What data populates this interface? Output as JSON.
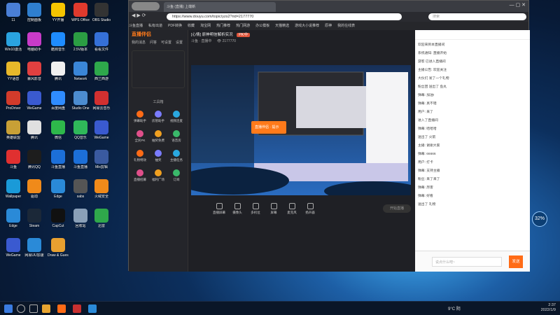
{
  "desktop": {
    "icons": [
      {
        "label": "11",
        "c": "#4a7fd6"
      },
      {
        "label": "控制面板",
        "c": "#2f7fcf"
      },
      {
        "label": "YY开播",
        "c": "#f5c400"
      },
      {
        "label": "WPS Office",
        "c": "#e03a2d"
      },
      {
        "label": "OBS Studio",
        "c": "#333"
      },
      {
        "label": "Win10激活",
        "c": "#2aa3e0"
      },
      {
        "label": "电脑助手",
        "c": "#c83bc8"
      },
      {
        "label": "酷狗音乐",
        "c": "#1e8cff"
      },
      {
        "label": "2.5V版本",
        "c": "#2b9d43"
      },
      {
        "label": "看看文件",
        "c": "#3570d8"
      },
      {
        "label": "YY语音",
        "c": "#e8b82a"
      },
      {
        "label": "暴风影音",
        "c": "#e04040"
      },
      {
        "label": "腾讯",
        "c": "#f0f0f0"
      },
      {
        "label": "Network",
        "c": "#3a86d8"
      },
      {
        "label": "西兰西游",
        "c": "#2ea84b"
      },
      {
        "label": "ProDriver",
        "c": "#d23b2b"
      },
      {
        "label": "WeGame",
        "c": "#3a5ad0"
      },
      {
        "label": "百度网盘",
        "c": "#2f8cff"
      },
      {
        "label": "Studio One",
        "c": "#4c8cd0"
      },
      {
        "label": "网易云音乐",
        "c": "#d23030"
      },
      {
        "label": "英雄联盟",
        "c": "#c8a036"
      },
      {
        "label": "腾讯",
        "c": "#e0e0e0"
      },
      {
        "label": "微信",
        "c": "#2eb84b"
      },
      {
        "label": "QQ音乐",
        "c": "#2fb85a"
      },
      {
        "label": "WeGame",
        "c": "#3a5ad0"
      },
      {
        "label": "斗鱼",
        "c": "#e03030"
      },
      {
        "label": "腾讯QQ",
        "c": "#1d1d1d"
      },
      {
        "label": "斗鱼直播",
        "c": "#1c6fd8"
      },
      {
        "label": "斗鱼直播",
        "c": "#1c6fd8"
      },
      {
        "label": "Mix剪辑",
        "c": "#3a5aa0"
      },
      {
        "label": "Wallpaper",
        "c": "#1a9ad8"
      },
      {
        "label": "驱动",
        "c": "#f08a1a"
      },
      {
        "label": "Edge",
        "c": "#2a8ad8"
      },
      {
        "label": "sabs",
        "c": "#555"
      },
      {
        "label": "火绒安全",
        "c": "#f08a1a"
      },
      {
        "label": "Edge",
        "c": "#2a8ad8"
      },
      {
        "label": "Steam",
        "c": "#1b2838"
      },
      {
        "label": "CapCut",
        "c": "#111"
      },
      {
        "label": "回收站",
        "c": "#8aa0b8"
      },
      {
        "label": "迅雷",
        "c": "#2fa84b"
      },
      {
        "label": "WeGame",
        "c": "#3a5ad0"
      },
      {
        "label": "网易UU加速",
        "c": "#2a8ad8"
      },
      {
        "label": "Draw & Guess",
        "c": "#e8a030"
      }
    ]
  },
  "browser": {
    "tab_label": "斗鱼 (直播) 上端新",
    "url": "https://www.douyu.com/topic/yzs2?rid=2177770",
    "search_placeholder": "搜索",
    "bookmarks": [
      "斗鱼直播",
      "私有出道",
      "PDF转换",
      "收藏",
      "淘宝网",
      "热门推荐",
      "热门网游",
      "办公模板",
      "天猫精选",
      "游戏大小说推荐",
      "原神",
      "我的在线表"
    ]
  },
  "site": {
    "logo": "直播伴侣",
    "subnav": [
      "我的消息",
      "问答",
      "可设置",
      "设置"
    ],
    "sidebar_functions": [
      "弹幕助手",
      "房管助手",
      "视频连麦",
      "全民PK",
      "抽奖免费",
      "语音房",
      "礼物特效",
      "抽奖",
      "主播任务",
      "直播招募",
      "福利广场",
      "订阅"
    ],
    "stream_title": "[心情] 原神明信解析实况",
    "title_tag": "PK中",
    "status": "斗鱼 · 直播中",
    "viewers": "2177770",
    "overlay_label": "直播伴侣 · 提示",
    "toolbar_items": [
      "直播屏幕",
      "摄像头",
      "多机位",
      "屏幕",
      "麦克风",
      "扬声器"
    ],
    "toolbar_button": "开始直播",
    "chat_messages": [
      "欢迎来到本直播间",
      "系统通知: 直播开始",
      "游客 已进入直播间",
      "主播公告: 欢迎关注",
      "大伙们 发了一个礼物",
      "粉丝团 送出了 鱼丸",
      "弹幕: 加油!",
      "弹幕: 真不错",
      "用户: 来了",
      "进入了直播间",
      "弹幕: 哈哈哈",
      "送出了 火箭",
      "主播: 谢谢大家",
      "弹幕: 66666",
      "用户: 打卡",
      "弹幕: 支持主播",
      "粉丝: 来了来了",
      "弹幕: 厉害",
      "弹幕: 好看",
      "送出了 礼物"
    ],
    "chat_input_placeholder": "说点什么吧~",
    "send_label": "发送"
  },
  "badge": "32%",
  "taskbar": {
    "weather": "9°C 阴",
    "time": "2:37",
    "date": "2022/1/9"
  }
}
